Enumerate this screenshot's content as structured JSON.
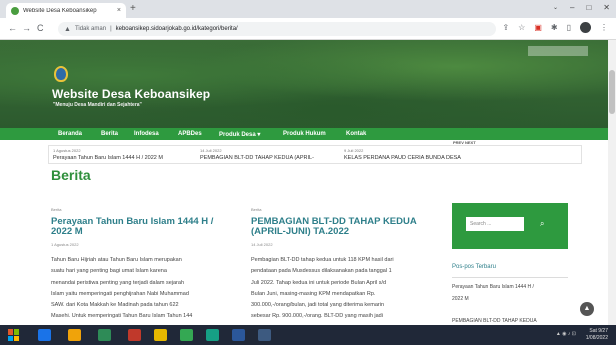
{
  "browser": {
    "tab_title": "Website Desa Keboansikep",
    "tab_close": "×",
    "new_tab": "+",
    "url_security": "Tidak aman",
    "url": "keboansikep.sidoarjokab.go.id/kategori/berita/",
    "window_controls": [
      "⌄",
      "–",
      "□",
      "✕"
    ],
    "nav": {
      "back": "←",
      "forward": "→",
      "reload": "C"
    }
  },
  "site": {
    "title": "Website Desa Keboansikep",
    "tagline": "\"Menuju Desa Mandiri dan Sejahtera\"",
    "menu": [
      "Beranda",
      "Berita",
      "Infodesa",
      "APBDes",
      "Produk Desa ▾",
      "Produk Hukum",
      "Kontak"
    ],
    "ticker_nav": "PREV NEXT",
    "ticker": [
      {
        "date": "1 Agustus 2022",
        "title": "Perayaan Tahun Baru Islam 1444 H / 2022 M"
      },
      {
        "date": "14 Juli 2022",
        "title": "PEMBAGIAN BLT-DD TAHAP KEDUA (APRIL-"
      },
      {
        "date": "9 Juli 2022",
        "title": "KELAS PERDANA PAUD CERIA BUNDA DESA"
      }
    ],
    "section_title": "Berita"
  },
  "posts": [
    {
      "category": "Berita",
      "title": "Perayaan Tahun Baru Islam 1444 H / 2022 M",
      "date": "1 Agustus 2022",
      "lines": [
        "Tahun Baru Hijriah atau Tahun Baru Islam merupakan",
        "suatu hari yang penting bagi umat Islam karena",
        "menandai peristiwa penting yang terjadi dalam sejarah",
        "Islam yaitu memperingati penghijrahan Nabi Muhammad",
        "SAW. dari Kota Makkah ke Madinah pada tahun 622",
        "Masehi. Untuk memperingati Tahun Baru Islam Tahun 144"
      ]
    },
    {
      "category": "Berita",
      "title": "PEMBAGIAN BLT-DD TAHAP KEDUA (APRIL-JUNI) TA.2022",
      "date": "14 Juli 2022",
      "lines": [
        "Pembagian BLT-DD tahap kedua untuk 118 KPM hasil dari",
        "pendataan pada Musdessus dilaksanakan pada tanggal 1",
        "Juli 2022. Tahap kedua ini untuk periode Bulan April s/d",
        "Bulan Juni, masing-masing KPM mendapatkan Rp.",
        "300.000,-/orang/bulan, jadi total yang diterima kemarin",
        "sebesar Rp. 900.000,-/orang. BLT-DD yang masih jadi"
      ]
    }
  ],
  "sidebar": {
    "search_placeholder": "Search ...",
    "search_icon": "⌕",
    "posts_title": "Pos-pos Terbaru",
    "items": [
      "Perayaan Tahun Baru Islam 1444 H /",
      "2022 M",
      "PEMBAGIAN BLT-DD TAHAP KEDUA"
    ]
  },
  "taskbar": {
    "time": "Sat 9/27",
    "date": "1/08/2022"
  },
  "colors": {
    "brand_green": "#2e9a3f",
    "heading_green": "#2e8f3b",
    "post_title_teal": "#2e7f8a"
  }
}
